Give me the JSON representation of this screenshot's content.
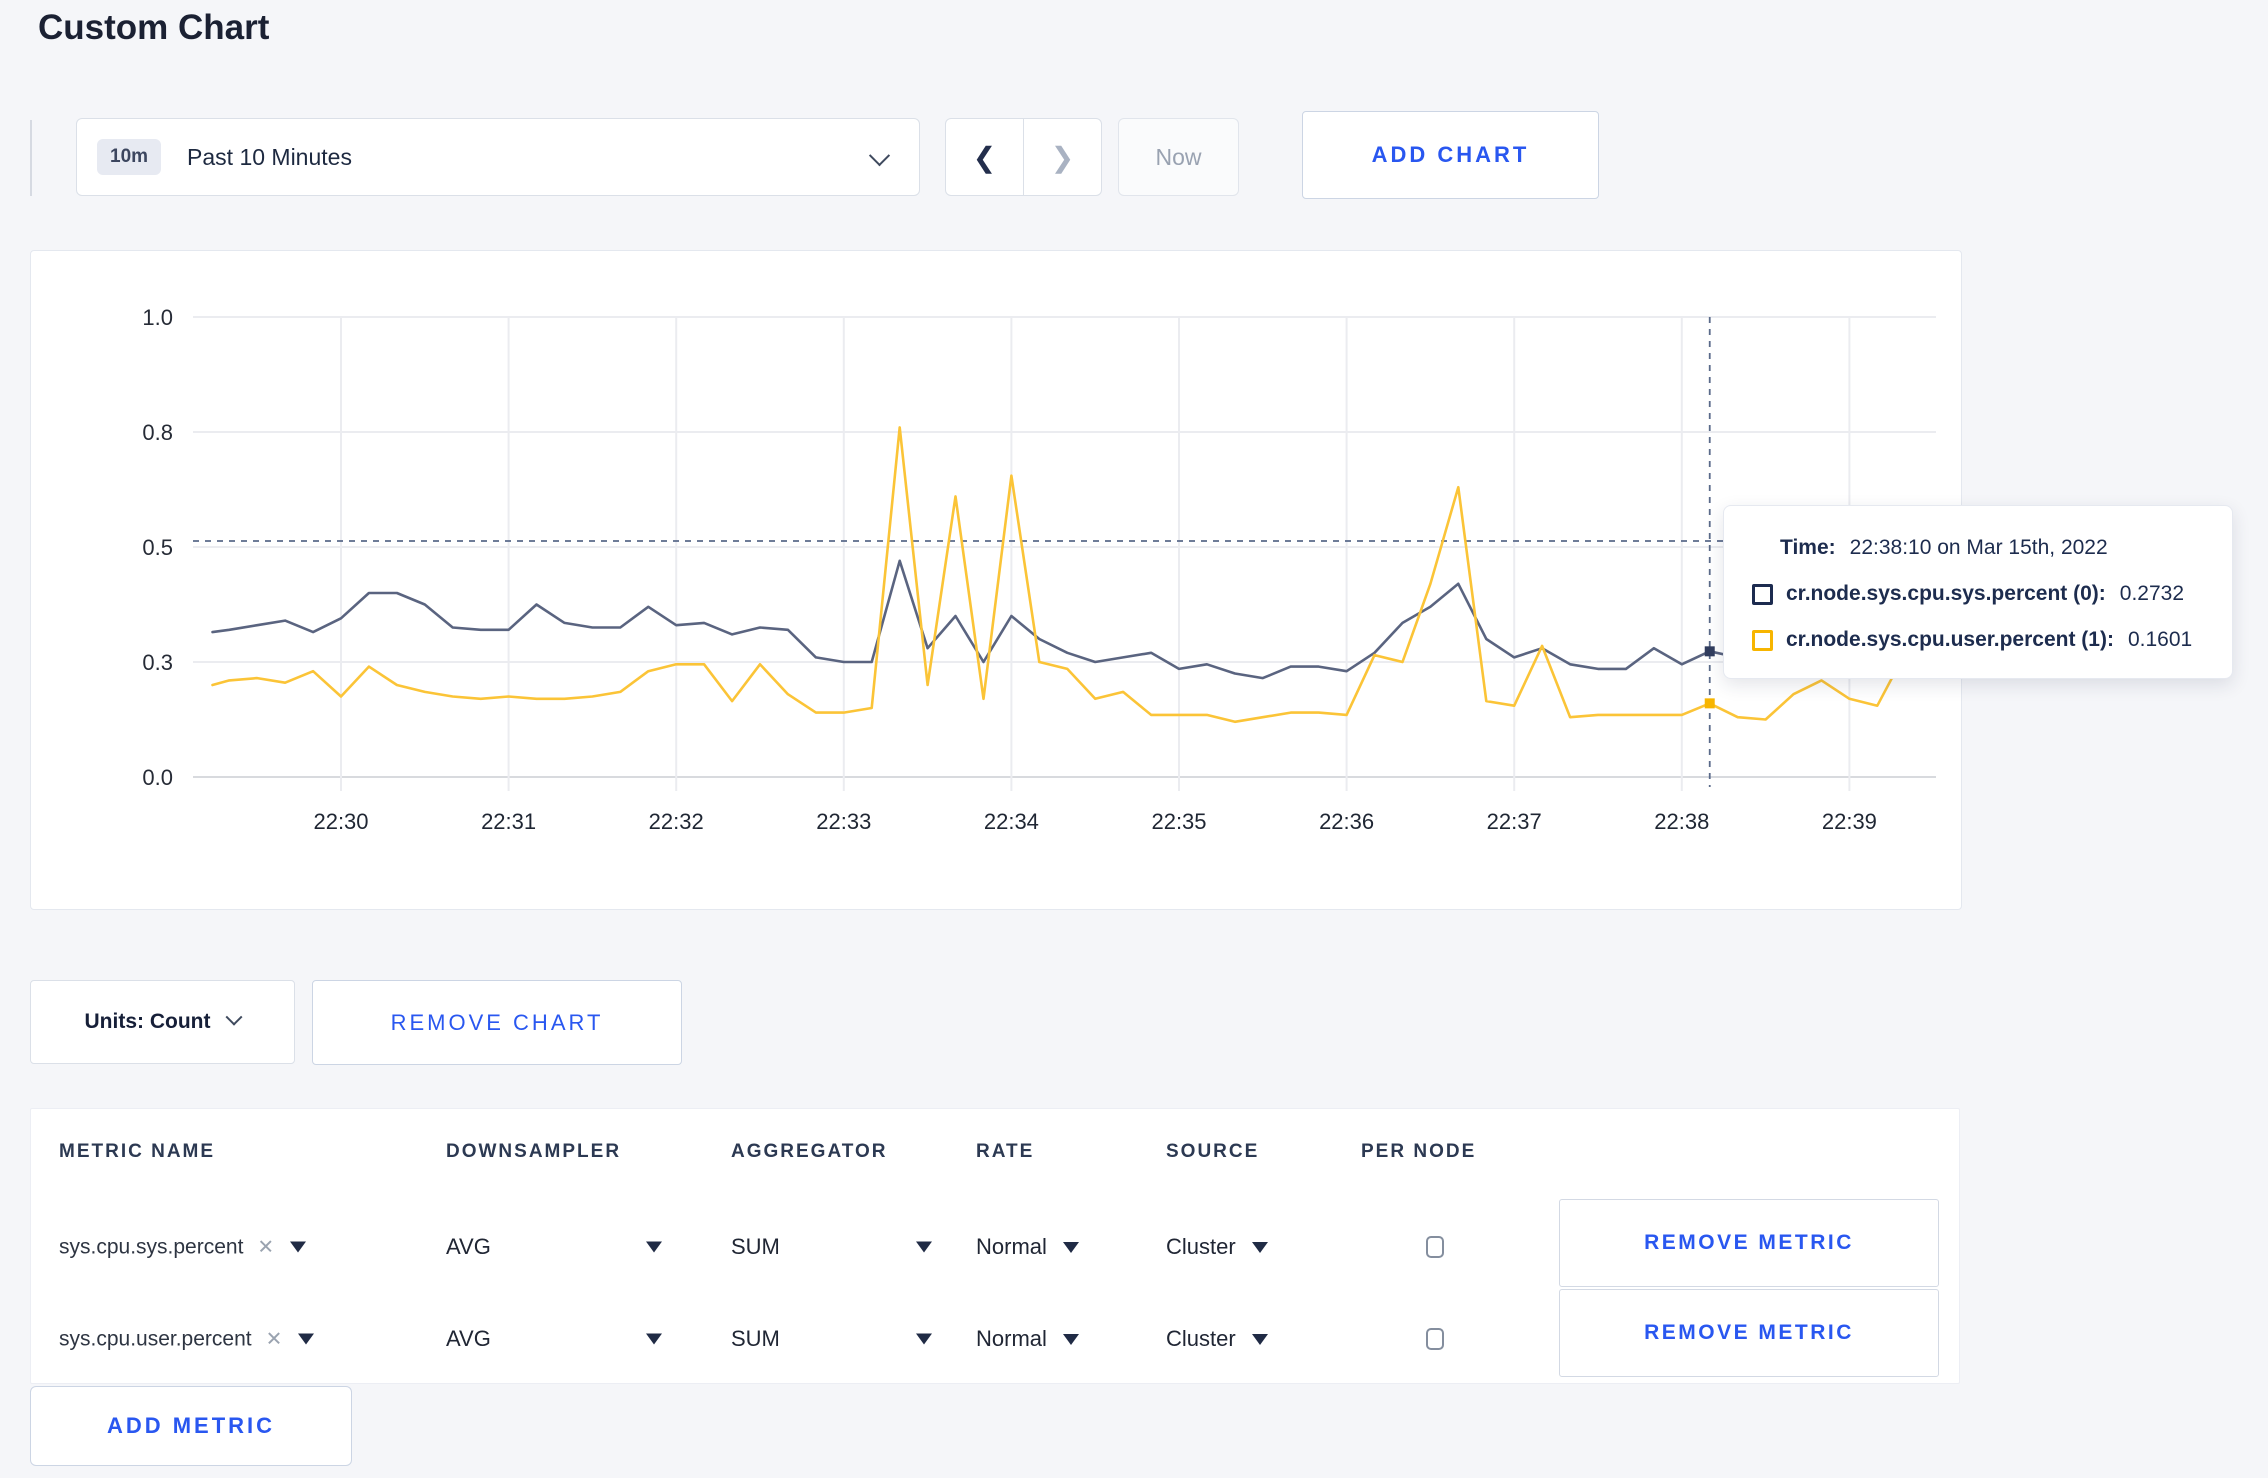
{
  "page": {
    "title": "Custom Chart",
    "accent": "#2957f0",
    "background": "#f5f6f9"
  },
  "toolbar": {
    "time_badge": "10m",
    "time_range_label": "Past 10 Minutes",
    "prev_icon": "chevron-left",
    "next_icon": "chevron-right",
    "now_label": "Now",
    "add_chart_label": "ADD CHART"
  },
  "chart_card": {
    "tooltip": {
      "time_label": "Time:",
      "time_value": "22:38:10 on Mar 15th, 2022",
      "series": [
        {
          "label": "cr.node.sys.cpu.sys.percent (0):",
          "value": "0.2732",
          "color": "#1c2b4f"
        },
        {
          "label": "cr.node.sys.cpu.user.percent (1):",
          "value": "0.1601",
          "color": "#f7b500"
        }
      ]
    },
    "units_label": "Units: Count",
    "remove_chart_label": "REMOVE CHART"
  },
  "chart_data": {
    "type": "line",
    "title": "",
    "xlabel": "",
    "ylabel": "",
    "ylim": [
      0,
      1
    ],
    "grid": true,
    "x_ticks": [
      "22:30",
      "22:31",
      "22:32",
      "22:33",
      "22:34",
      "22:35",
      "22:36",
      "22:37",
      "22:38",
      "22:39"
    ],
    "y_ticks": [
      {
        "value": 0,
        "label": "0.0"
      },
      {
        "value": 0.25,
        "label": "0.3"
      },
      {
        "value": 0.5,
        "label": "0.5"
      },
      {
        "value": 0.75,
        "label": "0.8"
      },
      {
        "value": 1.0,
        "label": "1.0"
      }
    ],
    "crosshair": {
      "time": "22:38:10",
      "hline_value": 0.513
    },
    "x": [
      "22:29:14",
      "22:29:20",
      "22:29:30",
      "22:29:40",
      "22:29:50",
      "22:30:00",
      "22:30:10",
      "22:30:20",
      "22:30:30",
      "22:30:40",
      "22:30:50",
      "22:31:00",
      "22:31:10",
      "22:31:20",
      "22:31:30",
      "22:31:40",
      "22:31:50",
      "22:32:00",
      "22:32:10",
      "22:32:20",
      "22:32:30",
      "22:32:40",
      "22:32:50",
      "22:33:00",
      "22:33:10",
      "22:33:20",
      "22:33:30",
      "22:33:40",
      "22:33:50",
      "22:34:00",
      "22:34:10",
      "22:34:20",
      "22:34:30",
      "22:34:40",
      "22:34:50",
      "22:35:00",
      "22:35:10",
      "22:35:20",
      "22:35:30",
      "22:35:40",
      "22:35:50",
      "22:36:00",
      "22:36:10",
      "22:36:20",
      "22:36:30",
      "22:36:40",
      "22:36:50",
      "22:37:00",
      "22:37:10",
      "22:37:20",
      "22:37:30",
      "22:37:40",
      "22:37:50",
      "22:38:00",
      "22:38:10",
      "22:38:20",
      "22:38:30",
      "22:38:40",
      "22:38:50",
      "22:39:00",
      "22:39:10",
      "22:39:20"
    ],
    "series": [
      {
        "name": "cr.node.sys.cpu.sys.percent",
        "color": "#5a6480",
        "marker_color": "#313d5e",
        "values": [
          0.315,
          0.32,
          0.33,
          0.34,
          0.315,
          0.345,
          0.4,
          0.4,
          0.375,
          0.325,
          0.32,
          0.32,
          0.375,
          0.335,
          0.325,
          0.325,
          0.37,
          0.33,
          0.335,
          0.31,
          0.325,
          0.32,
          0.26,
          0.25,
          0.25,
          0.47,
          0.28,
          0.35,
          0.25,
          0.35,
          0.3,
          0.27,
          0.25,
          0.26,
          0.27,
          0.235,
          0.245,
          0.225,
          0.215,
          0.24,
          0.24,
          0.23,
          0.27,
          0.335,
          0.37,
          0.42,
          0.3,
          0.26,
          0.28,
          0.245,
          0.235,
          0.235,
          0.28,
          0.245,
          0.2732,
          0.26,
          0.27,
          0.275,
          0.27,
          0.28,
          0.285,
          0.3
        ]
      },
      {
        "name": "cr.node.sys.cpu.user.percent",
        "color": "#fbc437",
        "marker_color": "#f7b500",
        "values": [
          0.2,
          0.21,
          0.215,
          0.205,
          0.23,
          0.175,
          0.24,
          0.2,
          0.185,
          0.175,
          0.17,
          0.175,
          0.17,
          0.17,
          0.175,
          0.185,
          0.23,
          0.245,
          0.245,
          0.165,
          0.245,
          0.18,
          0.14,
          0.14,
          0.15,
          0.76,
          0.2,
          0.61,
          0.17,
          0.655,
          0.25,
          0.235,
          0.17,
          0.185,
          0.135,
          0.135,
          0.135,
          0.12,
          0.13,
          0.14,
          0.14,
          0.135,
          0.265,
          0.25,
          0.42,
          0.63,
          0.165,
          0.155,
          0.285,
          0.13,
          0.135,
          0.135,
          0.135,
          0.135,
          0.1601,
          0.13,
          0.125,
          0.18,
          0.21,
          0.17,
          0.155,
          0.27
        ]
      }
    ]
  },
  "metrics_table": {
    "headers": [
      "METRIC NAME",
      "DOWNSAMPLER",
      "AGGREGATOR",
      "RATE",
      "SOURCE",
      "PER NODE"
    ],
    "rows": [
      {
        "metric_name": "sys.cpu.sys.percent",
        "downsampler": "AVG",
        "aggregator": "SUM",
        "rate": "Normal",
        "source": "Cluster",
        "per_node_checked": false,
        "remove_label": "REMOVE METRIC"
      },
      {
        "metric_name": "sys.cpu.user.percent",
        "downsampler": "AVG",
        "aggregator": "SUM",
        "rate": "Normal",
        "source": "Cluster",
        "per_node_checked": false,
        "remove_label": "REMOVE METRIC"
      }
    ],
    "add_metric_label": "ADD METRIC"
  }
}
